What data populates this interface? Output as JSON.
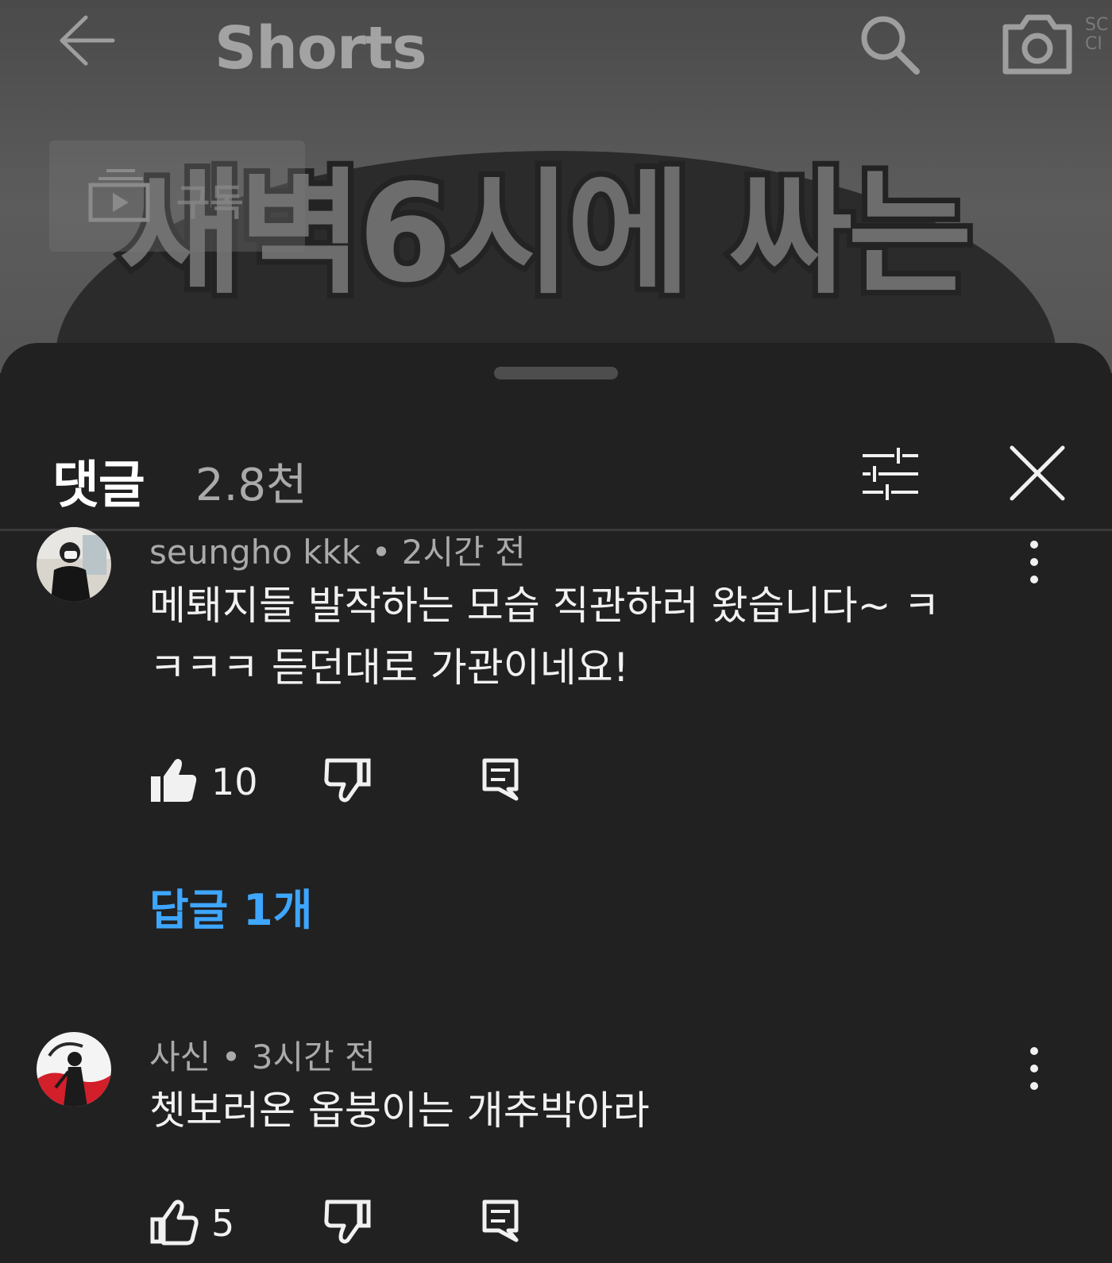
{
  "topbar": {
    "title": "Shorts",
    "edge_text": "SC CI"
  },
  "video": {
    "caption_line1": "새벽6시에 싸는",
    "subscribe_label": "구독"
  },
  "comments_sheet": {
    "title": "댓글",
    "count": "2.8천"
  },
  "comments": [
    {
      "author": "seungho kkk",
      "time": "2시간 전",
      "meta": "seungho kkk • 2시간 전",
      "text": "메퇘지들 발작하는 모습 직관하러 왔습니다~ ㅋㅋㅋㅋ 듣던대로 가관이네요!",
      "likes": "10",
      "liked": true,
      "replies_label": "답글 1개"
    },
    {
      "author": "사신",
      "time": "3시간 전",
      "meta": "사신 • 3시간 전",
      "text": "쳇보러온 옵붕이는 개추박아라",
      "likes": "5",
      "liked": false
    }
  ],
  "icons": {
    "back": "back-arrow-icon",
    "search": "search-icon",
    "camera": "camera-icon",
    "filter": "filter-sliders-icon",
    "close": "close-icon",
    "more": "more-vertical-icon",
    "like": "thumbs-up-icon",
    "dislike": "thumbs-down-icon",
    "reply": "reply-comment-icon"
  },
  "colors": {
    "sheet_background": "#212121",
    "link_blue": "#3ea6ff",
    "secondary_text": "#aaaaaa"
  }
}
